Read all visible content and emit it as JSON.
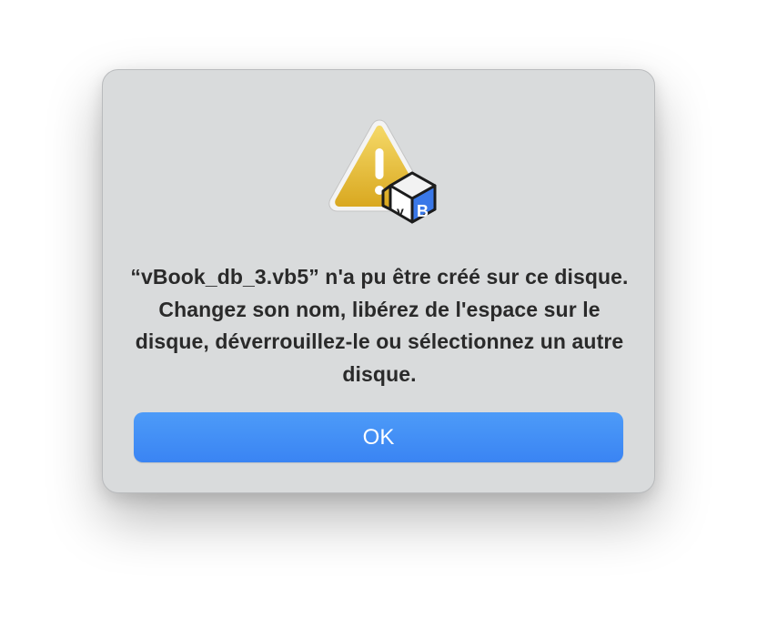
{
  "dialog": {
    "message": "“vBook_db_3.vb5” n'a pu être créé sur ce disque. Changez son nom, libérez de l'espace sur le disque, déverrouillez-le ou sélectionnez un autre disque.",
    "icon": "warning-triangle-icon",
    "app_badge_letter": "B",
    "app_badge_prefix": "v",
    "ok_label": "OK"
  },
  "colors": {
    "dialog_background": "#d9dbdc",
    "warning_yellow": "#e9c13f",
    "button_blue": "#3d89f4",
    "badge_blue": "#3a78e8"
  }
}
